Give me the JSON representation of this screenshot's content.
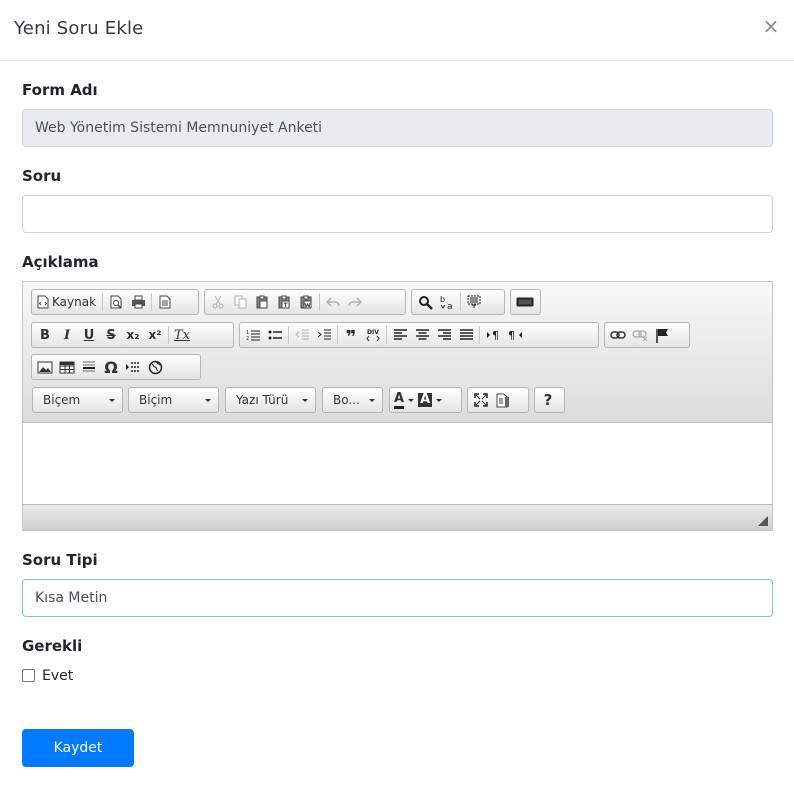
{
  "modal": {
    "title": "Yeni Soru Ekle",
    "close_label": "×"
  },
  "form": {
    "form_name": {
      "label": "Form Adı",
      "value": "Web Yönetim Sistemi Memnuniyet Anketi"
    },
    "question": {
      "label": "Soru",
      "value": ""
    },
    "description": {
      "label": "Açıklama"
    },
    "question_type": {
      "label": "Soru Tipi",
      "value": "Kısa Metin"
    },
    "required": {
      "label": "Gerekli",
      "option_label": "Evet",
      "checked": false
    },
    "submit_label": "Kaydet"
  },
  "editor": {
    "source_label": "Kaynak",
    "bold": "B",
    "italic": "I",
    "underline": "U",
    "strike": "S",
    "subscript": "x₂",
    "superscript": "x²",
    "remove_format": "Tx",
    "blockquote": "❞",
    "omega": "Ω",
    "help": "?",
    "combos": [
      "Biçem",
      "Biçim",
      "Yazı Türü",
      "Bo..."
    ],
    "text_color_letter": "A",
    "bg_color_letter": "A"
  },
  "colors": {
    "primary": "#007bff",
    "readonly_bg": "#e9ecef",
    "focus_border": "#80bdff"
  }
}
